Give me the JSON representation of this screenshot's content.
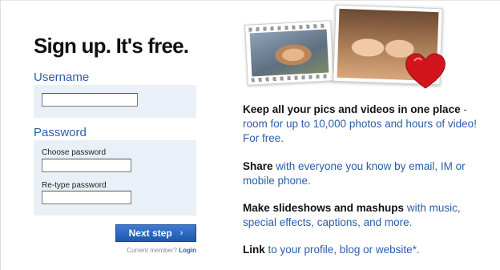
{
  "title": "Sign up. It's free.",
  "username": {
    "label": "Username",
    "value": ""
  },
  "password": {
    "label": "Password",
    "choose_label": "Choose password",
    "choose_value": "",
    "retype_label": "Re-type password",
    "retype_value": ""
  },
  "next_button": {
    "label": "Next step",
    "arrow": "›"
  },
  "member": {
    "prompt": "Current member?",
    "login_label": "Login"
  },
  "features": [
    {
      "bold": "Keep all your pics and videos in one place",
      "rest": " - room for up to 10,000 photos and hours of video! For free."
    },
    {
      "bold": "Share",
      "rest": " with everyone you know by email, IM or mobile phone."
    },
    {
      "bold": "Make slideshows and mashups",
      "rest": " with music, special effects, captions, and more."
    },
    {
      "bold": "Link",
      "rest": " to your profile, blog or website*."
    }
  ],
  "colors": {
    "link_blue": "#2a5ea8",
    "panel_bg": "#eaf0f7",
    "button_blue": "#2b66bf",
    "heart_red": "#d2141c"
  },
  "icons": {
    "heart": "heart-icon",
    "arrow": "chevron-right-icon"
  }
}
